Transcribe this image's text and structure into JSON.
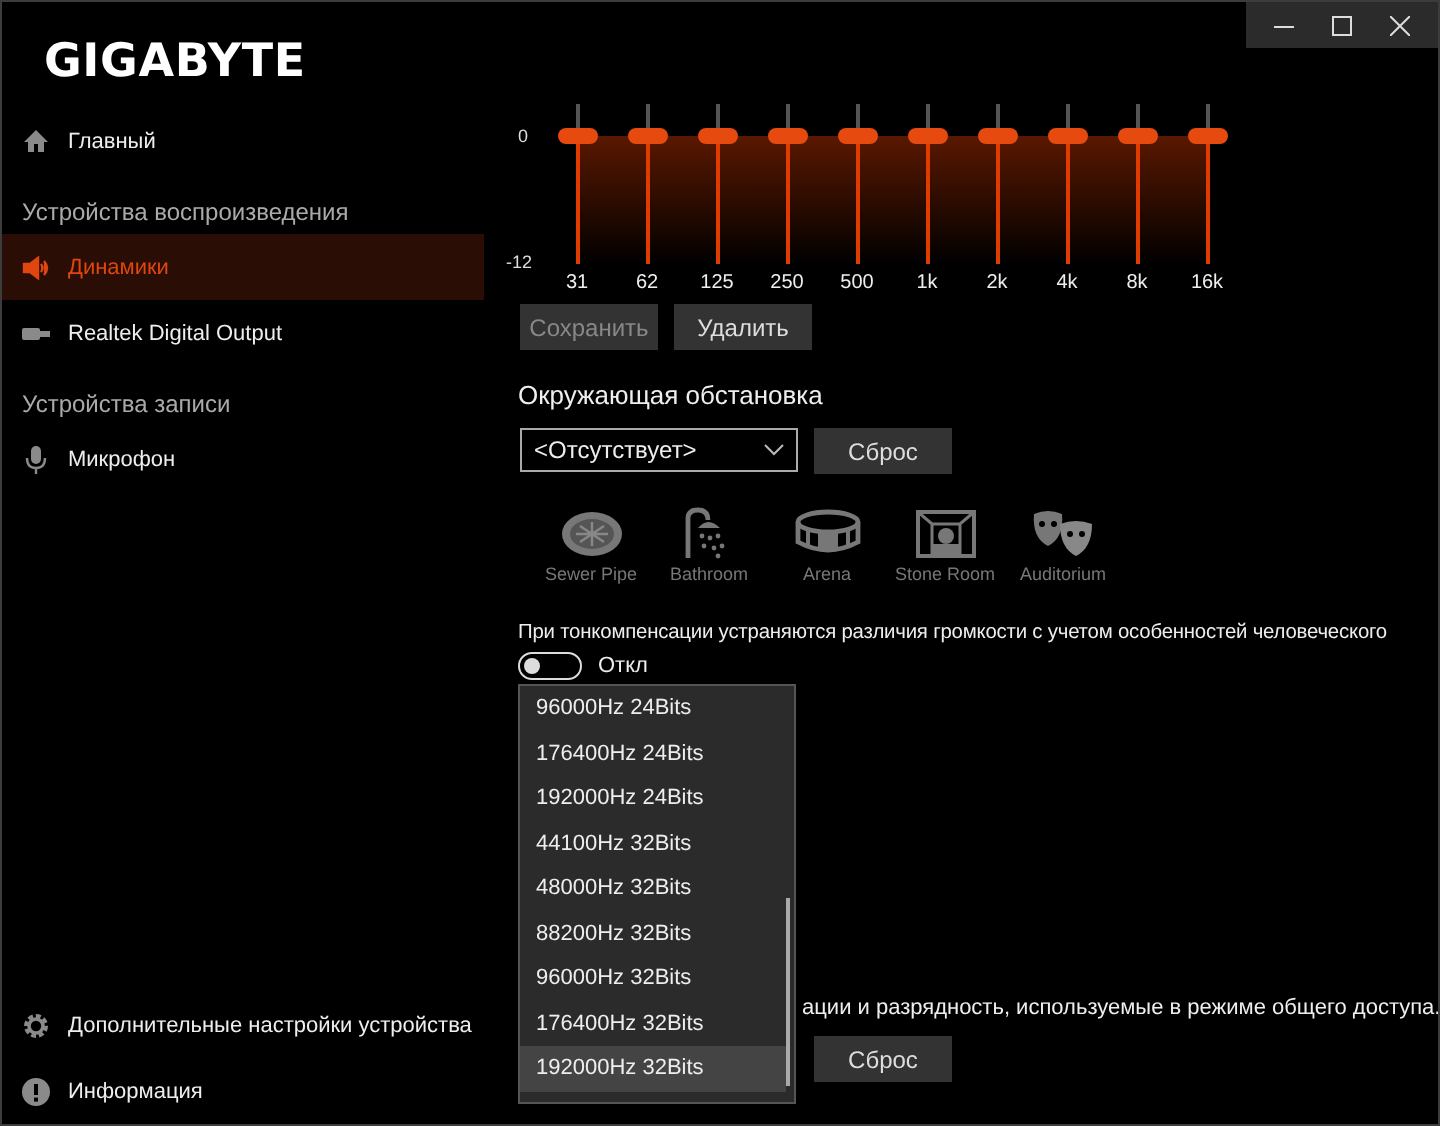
{
  "sidebar": {
    "logo": "GIGABYTE",
    "home": {
      "label": "Главный",
      "selected": false
    },
    "sections": [
      {
        "title": "Устройства воспроизведения",
        "items": [
          {
            "label": "Динамики",
            "selected": true
          },
          {
            "label": "Realtek Digital Output",
            "selected": false
          }
        ]
      },
      {
        "title": "Устройства записи",
        "items": [
          {
            "label": "Микрофон",
            "selected": false
          }
        ]
      }
    ],
    "footer": [
      {
        "label": "Дополнительные настройки устройства"
      },
      {
        "label": "Информация"
      }
    ]
  },
  "equalizer": {
    "scale": [
      "0",
      "-12"
    ],
    "bands": [
      {
        "label": "31",
        "level": 0.8
      },
      {
        "label": "62",
        "level": 0.8
      },
      {
        "label": "125",
        "level": 0.8
      },
      {
        "label": "250",
        "level": 0.8
      },
      {
        "label": "500",
        "level": 0.8
      },
      {
        "label": "1k",
        "level": 0.8
      },
      {
        "label": "2k",
        "level": 0.8
      },
      {
        "label": "4k",
        "level": 0.8
      },
      {
        "label": "8k",
        "level": 0.8
      },
      {
        "label": "16k",
        "level": 0.8
      }
    ],
    "buttons": [
      {
        "label": "Сохранить",
        "disabled": true
      },
      {
        "label": "Удалить",
        "disabled": false
      }
    ]
  },
  "environment": {
    "title": "Окружающая обстановка",
    "select": {
      "value": "<Отсутствует>"
    },
    "reset": "Сброс",
    "presets": [
      {
        "label": "Sewer Pipe"
      },
      {
        "label": "Bathroom"
      },
      {
        "label": "Arena"
      },
      {
        "label": "Stone Room"
      },
      {
        "label": "Auditorium"
      }
    ]
  },
  "loudness": {
    "description": "При тонкомпенсации устраняются различия громкости с учетом особенностей человеческого",
    "toggle": {
      "on": false,
      "label": "Откл"
    }
  },
  "format": {
    "description": "ации и разрядность, используемые в режиме общего доступа.",
    "reset": "Сброс",
    "dropdown": {
      "options": [
        {
          "label": "96000Hz 24Bits",
          "selected": false
        },
        {
          "label": "176400Hz 24Bits",
          "selected": false
        },
        {
          "label": "192000Hz 24Bits",
          "selected": false
        },
        {
          "label": "44100Hz 32Bits",
          "selected": false
        },
        {
          "label": "48000Hz 32Bits",
          "selected": false
        },
        {
          "label": "88200Hz 32Bits",
          "selected": false
        },
        {
          "label": "96000Hz 32Bits",
          "selected": false
        },
        {
          "label": "176400Hz 32Bits",
          "selected": false
        },
        {
          "label": "192000Hz 32Bits",
          "selected": true
        }
      ]
    }
  }
}
